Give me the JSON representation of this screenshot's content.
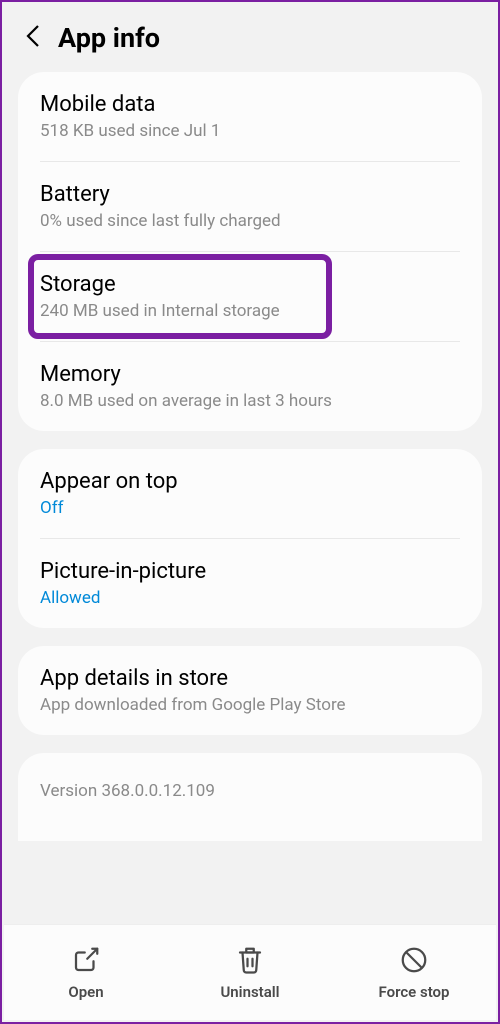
{
  "header": {
    "title": "App info"
  },
  "sections": {
    "group1": {
      "mobile_data": {
        "title": "Mobile data",
        "sub": "518 KB used since Jul 1"
      },
      "battery": {
        "title": "Battery",
        "sub": "0% used since last fully charged"
      },
      "storage": {
        "title": "Storage",
        "sub": "240 MB used in Internal storage"
      },
      "memory": {
        "title": "Memory",
        "sub": "8.0 MB used on average in last 3 hours"
      }
    },
    "group2": {
      "appear_on_top": {
        "title": "Appear on top",
        "status": "Off"
      },
      "pip": {
        "title": "Picture-in-picture",
        "status": "Allowed"
      }
    },
    "group3": {
      "details": {
        "title": "App details in store",
        "sub": "App downloaded from Google Play Store"
      }
    }
  },
  "version_text": "Version 368.0.0.12.109",
  "bottom": {
    "open": "Open",
    "uninstall": "Uninstall",
    "force_stop": "Force stop"
  },
  "highlight_color": "#7b1fa2"
}
